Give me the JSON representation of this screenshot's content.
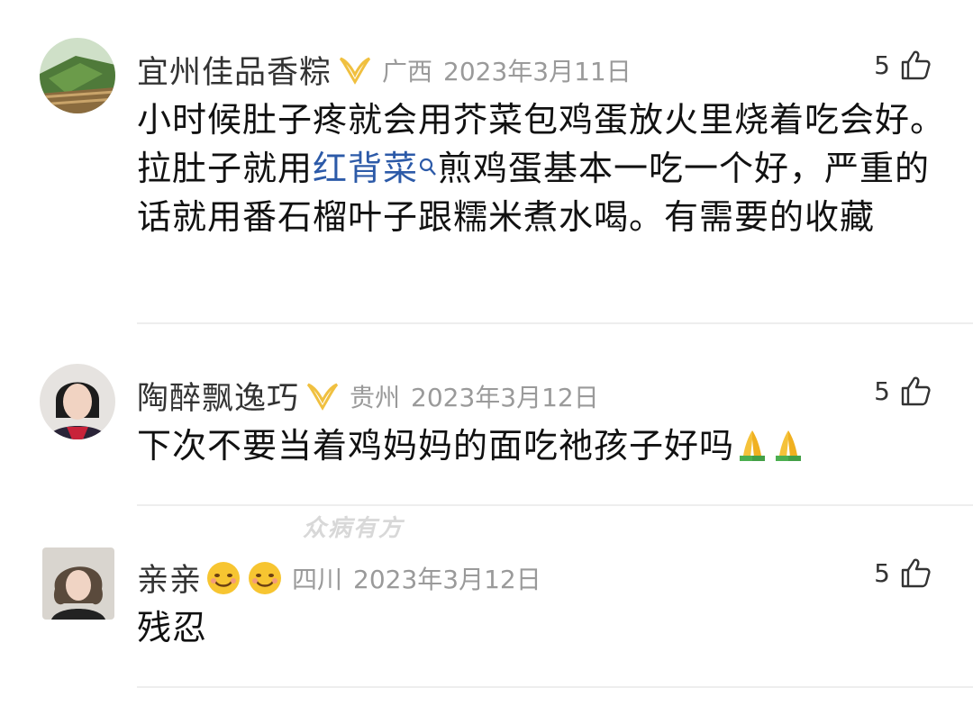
{
  "comments": [
    {
      "name": "宜州佳品香粽",
      "location": "广西",
      "date": "2023年3月11日",
      "likes": "5",
      "text_before_link": "小时候肚子疼就会用芥菜包鸡蛋放火里烧着吃会好。拉肚子就用",
      "link_text": "红背菜",
      "text_after_link": "煎鸡蛋基本一吃一个好，严重的话就用番石榴叶子跟糯米煮水喝。有需要的收藏",
      "icon_after_name": "yellow-badge-icon"
    },
    {
      "name": "陶醉飘逸巧",
      "location": "贵州",
      "date": "2023年3月12日",
      "likes": "5",
      "text": "下次不要当着鸡妈妈的面吃祂孩子好吗",
      "emojis": [
        "praying-hands-icon",
        "praying-hands-icon"
      ],
      "icon_after_name": "yellow-badge-icon"
    },
    {
      "name": "亲亲",
      "name_emojis": [
        "smiling-face-icon",
        "smiling-face-icon"
      ],
      "location": "四川",
      "date": "2023年3月12日",
      "likes": "5",
      "text": "残忍"
    }
  ],
  "watermark": "众病有方",
  "colors": {
    "link": "#2c5aa8",
    "meta": "#9a9a9a",
    "badge": "#f0c040"
  }
}
